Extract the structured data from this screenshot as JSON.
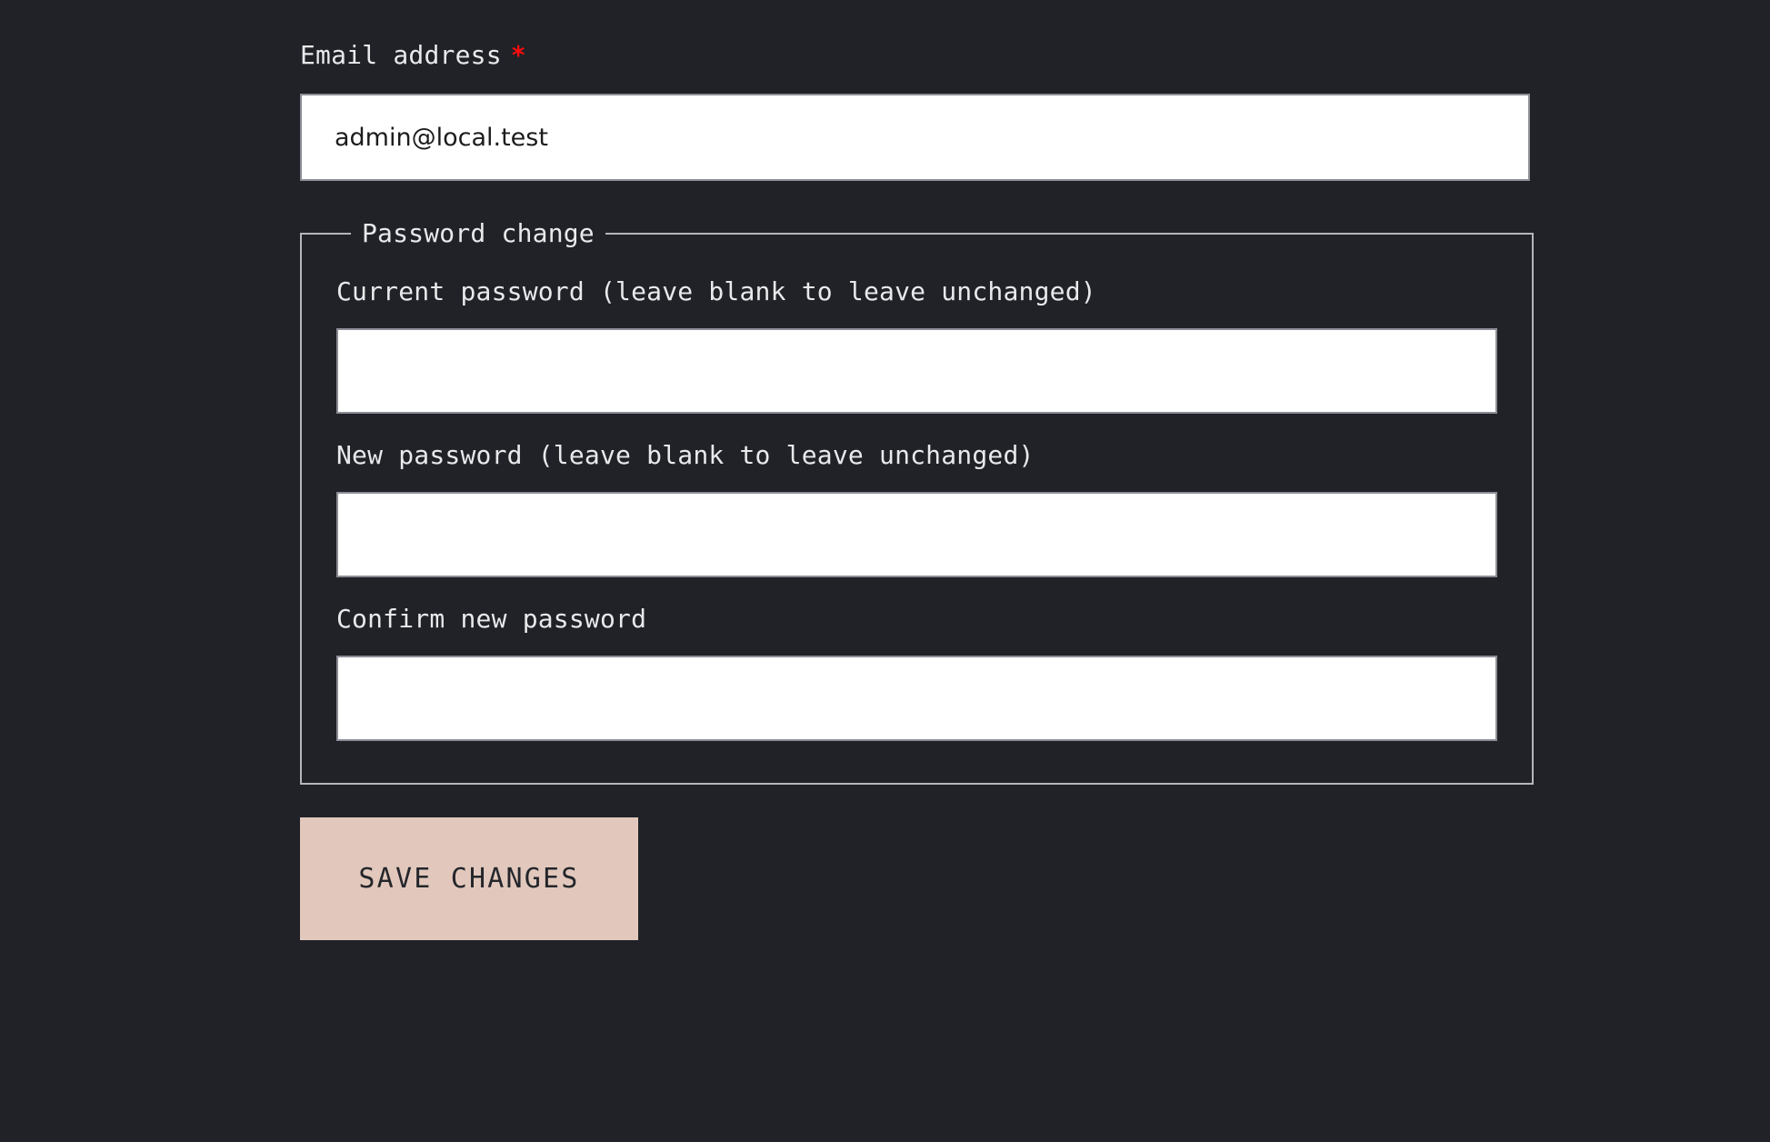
{
  "theme": {
    "background": "#202227",
    "label_color": "#e9e9ec",
    "input_background": "#ffffff",
    "input_border": "#8d8d97",
    "fieldset_border": "#b6b6bd",
    "required_marker_color": "#f50d0d",
    "button_background": "#e2c8bc",
    "button_text_color": "#24262b"
  },
  "form": {
    "email": {
      "label": "Email address",
      "required_marker": "*",
      "value": "admin@local.test",
      "placeholder": ""
    },
    "password_section": {
      "legend": "Password change",
      "fields": [
        {
          "label": "Current password (leave blank to leave unchanged)",
          "value": "",
          "placeholder": ""
        },
        {
          "label": "New password (leave blank to leave unchanged)",
          "value": "",
          "placeholder": ""
        },
        {
          "label": "Confirm new password",
          "value": "",
          "placeholder": ""
        }
      ]
    },
    "submit": {
      "label": "SAVE CHANGES"
    }
  }
}
